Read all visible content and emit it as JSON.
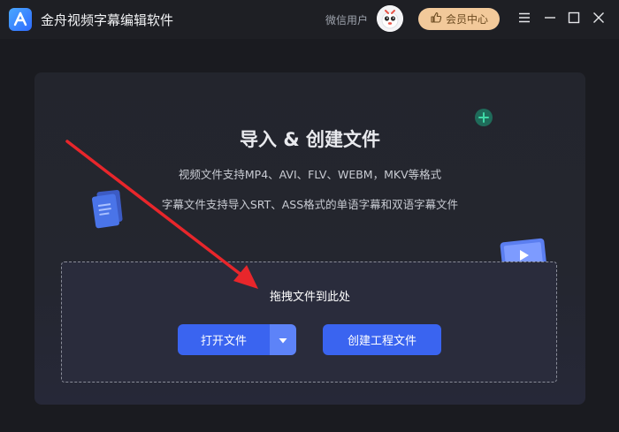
{
  "app": {
    "title": "金舟视频字幕编辑软件",
    "logo_icon": "app-logo-a-icon"
  },
  "header": {
    "username": "微信用户",
    "vip_label": "会员中心",
    "vip_icon": "thumbs-up-icon"
  },
  "window_controls": [
    "menu-icon",
    "minimize-icon",
    "maximize-icon",
    "close-icon"
  ],
  "main": {
    "heading": "导入 & 创建文件",
    "video_formats": "视频文件支持MP4、AVI、FLV、WEBM，MKV等格式",
    "subtitle_formats": "字幕文件支持导入SRT、ASS格式的单语字幕和双语字幕文件",
    "drop_hint": "拖拽文件到此处",
    "open_button": "打开文件",
    "create_button": "创建工程文件"
  },
  "colors": {
    "accent": "#3a64f0",
    "vip": "#f2c99a",
    "background": "#1a1b20",
    "annotation_arrow": "#e8262b"
  }
}
